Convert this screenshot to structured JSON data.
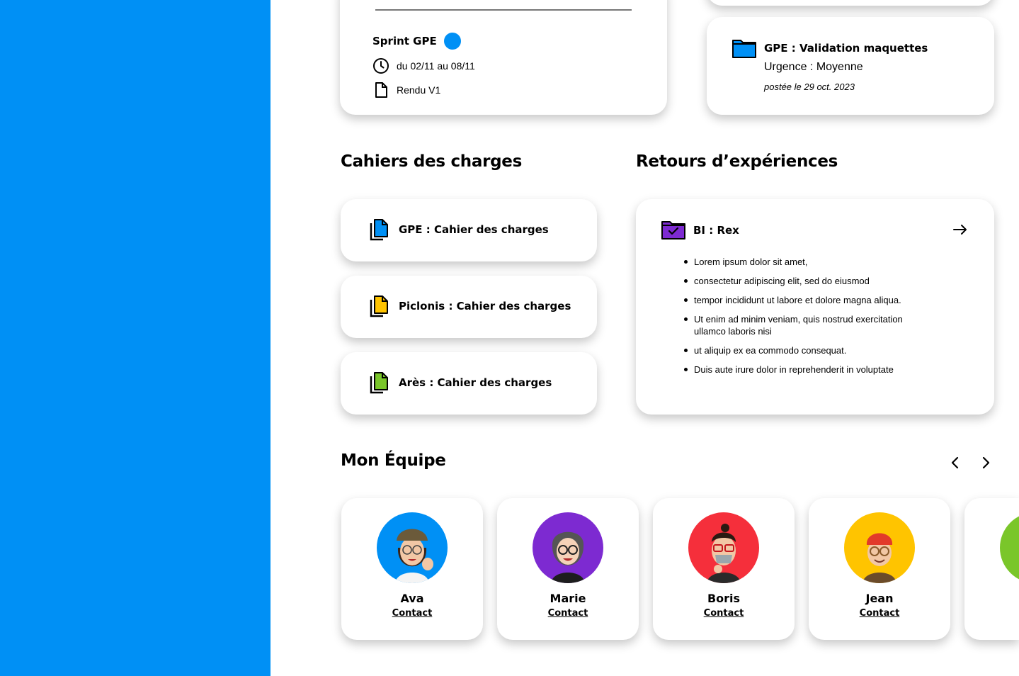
{
  "colors": {
    "primary": "#0090f5",
    "purple": "#7d2ad1",
    "red": "#f52f3b",
    "yellow": "#ffc400",
    "green": "#7ac62a"
  },
  "sprint": {
    "title": "Sprint GPE",
    "dates": "du 02/11 au 08/11",
    "deliverable": "Rendu V1",
    "icons": [
      "clock-icon",
      "file-icon"
    ]
  },
  "validation": {
    "title": "GPE : Validation maquettes",
    "urgency": "Urgence : Moyenne",
    "posted": "postée le 29 oct. 2023",
    "icon": "folder-icon"
  },
  "cahiers": {
    "heading": "Cahiers des charges",
    "items": [
      {
        "label": "GPE : Cahier des charges",
        "color": "#0090f5"
      },
      {
        "label": "Piclonis : Cahier des charges",
        "color": "#ffc400"
      },
      {
        "label": "Arès : Cahier des charges",
        "color": "#7ac62a"
      }
    ]
  },
  "rex": {
    "heading": "Retours d’expériences",
    "title": "BI : Rex",
    "bullets": [
      "Lorem ipsum dolor sit amet,",
      "consectetur adipiscing elit, sed do eiusmod",
      "tempor incididunt ut labore et dolore magna aliqua.",
      "Ut enim ad minim veniam, quis nostrud exercitation ullamco laboris nisi",
      "ut aliquip ex ea commodo consequat.",
      "Duis aute irure dolor in reprehenderit in voluptate"
    ]
  },
  "team": {
    "heading": "Mon Équipe",
    "members": [
      {
        "name": "Ava",
        "contact": "Contact",
        "color": "#0090f5"
      },
      {
        "name": "Marie",
        "contact": "Contact",
        "color": "#7d2ad1"
      },
      {
        "name": "Boris",
        "contact": "Contact",
        "color": "#f52f3b"
      },
      {
        "name": "Jean",
        "contact": "Contact",
        "color": "#ffc400"
      },
      {
        "name": "",
        "contact": "C",
        "color": "#7ac62a"
      }
    ]
  }
}
